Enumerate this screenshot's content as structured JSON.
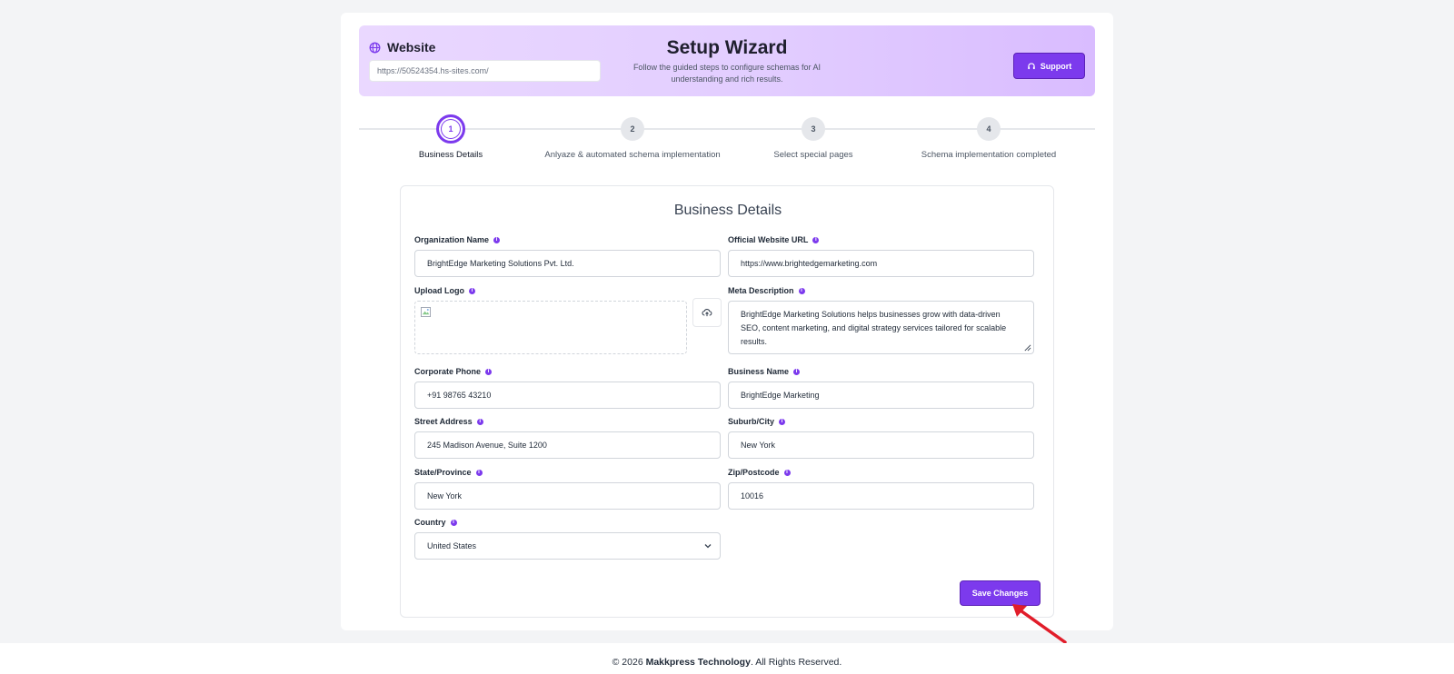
{
  "header": {
    "site_label": "Website",
    "site_url": "https://50524354.hs-sites.com/",
    "title": "Setup Wizard",
    "subtitle": "Follow the guided steps to configure schemas for AI understanding and rich results.",
    "support_label": "Support"
  },
  "steps": [
    {
      "number": "1",
      "label": "Business Details",
      "active": true
    },
    {
      "number": "2",
      "label": "Anlyaze & automated schema implementation",
      "active": false
    },
    {
      "number": "3",
      "label": "Select special pages",
      "active": false
    },
    {
      "number": "4",
      "label": "Schema implementation completed",
      "active": false
    }
  ],
  "form": {
    "title": "Business Details",
    "org_name": {
      "label": "Organization Name",
      "value": "BrightEdge Marketing Solutions Pvt. Ltd."
    },
    "website_url": {
      "label": "Official Website URL",
      "value": "https://www.brightedgemarketing.com"
    },
    "upload_logo": {
      "label": "Upload Logo"
    },
    "meta_description": {
      "label": "Meta Description",
      "value": "BrightEdge Marketing Solutions helps businesses grow with data-driven SEO, content marketing, and digital strategy services tailored for scalable results."
    },
    "phone": {
      "label": "Corporate Phone",
      "value": "+91 98765 43210"
    },
    "business_name": {
      "label": "Business Name",
      "value": "BrightEdge Marketing"
    },
    "street": {
      "label": "Street Address",
      "value": "245 Madison Avenue, Suite 1200"
    },
    "city": {
      "label": "Suburb/City",
      "value": "New York"
    },
    "state": {
      "label": "State/Province",
      "value": "New York"
    },
    "zip": {
      "label": "Zip/Postcode",
      "value": "10016"
    },
    "country": {
      "label": "Country",
      "value": "United States"
    },
    "save_label": "Save Changes"
  },
  "footer": {
    "prefix": "© 2026 ",
    "company": "Makkpress Technology",
    "suffix": ". All Rights Reserved."
  },
  "colors": {
    "accent": "#7c3aed",
    "header_gradient_start": "#ead8ff",
    "header_gradient_end": "#d9bcff",
    "annotation_arrow": "#e11d2a"
  },
  "icons": [
    "globe-icon",
    "headset-icon",
    "info-icon",
    "broken-image-icon",
    "cloud-upload-icon",
    "chevron-down-icon",
    "resize-handle-icon"
  ]
}
